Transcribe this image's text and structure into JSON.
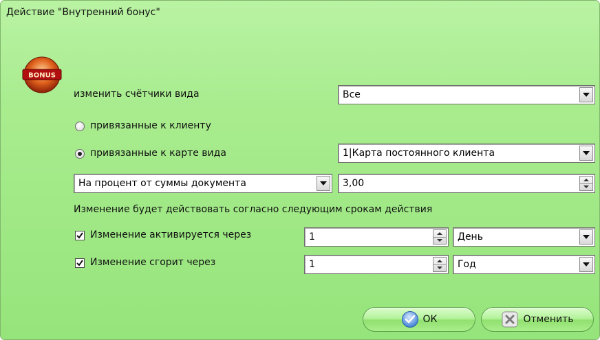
{
  "window": {
    "title": "Действие \"Внутренний бонус\""
  },
  "logo": {
    "text": "BONUS"
  },
  "counters": {
    "label": "изменить счётчики вида",
    "value": "Все"
  },
  "binding": {
    "client_label": "привязанные к клиенту",
    "client_selected": false,
    "card_label": "привязанные к карте вида",
    "card_selected": true,
    "card_value": "1|Карта постоянного клиента"
  },
  "mode": {
    "type_value": "На процент от суммы документа",
    "amount_value": "3,00"
  },
  "terms": {
    "heading": "Изменение будет действовать согласно следующим срокам действия",
    "activate": {
      "label": "Изменение активируется через",
      "checked": true,
      "count": "1",
      "unit": "День"
    },
    "expire": {
      "label": "Изменение сгорит через",
      "checked": true,
      "count": "1",
      "unit": "Год"
    }
  },
  "buttons": {
    "ok_label": "ОК",
    "cancel_label": "Отменить"
  },
  "colors": {
    "background": "#a7eb8d",
    "button_fill": "#b4f39b",
    "border": "#5aa048"
  }
}
